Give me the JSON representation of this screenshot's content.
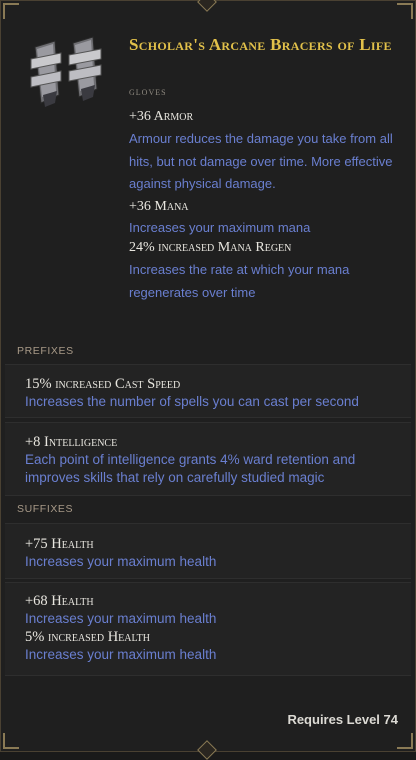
{
  "item": {
    "name": "Scholar's Arcane Bracers of Life",
    "type": "GLOVES",
    "icon": "bracers-icon"
  },
  "implicits": [
    {
      "stat": "+36 Armor",
      "desc": "Armour reduces the damage you take from all hits, but not damage over time. More effective against physical damage."
    },
    {
      "stat": "+36 Mana",
      "desc": "Increases your maximum mana"
    },
    {
      "stat": "24% increased Mana Regen",
      "desc": "Increases the rate at which your mana regenerates over time"
    }
  ],
  "prefixes": {
    "label": "PREFIXES",
    "affixes": [
      {
        "stat": "15% increased Cast Speed",
        "desc": "Increases the number of spells you can cast per second"
      },
      {
        "stat": "+8 Intelligence",
        "desc": "Each point of intelligence grants 4% ward retention and improves skills that rely on carefully studied magic"
      }
    ]
  },
  "suffixes": {
    "label": "SUFFIXES",
    "affixes": [
      {
        "stat": "+75 Health",
        "desc": "Increases your maximum health"
      },
      {
        "stat": "+68 Health",
        "desc": "Increases your maximum health"
      },
      {
        "stat": "5% increased Health",
        "desc": "Increases your maximum health"
      }
    ]
  },
  "requirement": "Requires Level 74",
  "colors": {
    "name": "#e2c14a",
    "stat": "#e8e6df",
    "desc": "#6a7fd0",
    "border": "#8a7a55"
  }
}
